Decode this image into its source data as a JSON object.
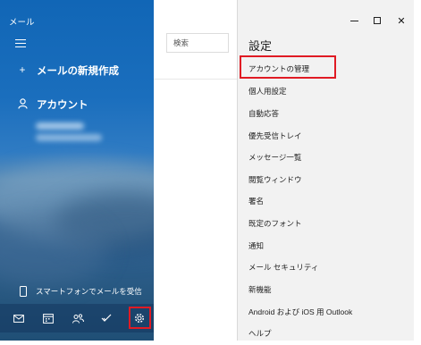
{
  "app": {
    "title": "メール"
  },
  "nav": {
    "new_mail_label": "メールの新規作成",
    "new_mail_icon": "+",
    "accounts_label": "アカウント",
    "phone_label": "スマートフォンでメールを受信",
    "bottom_icons": [
      "mail-icon",
      "calendar-icon",
      "people-icon",
      "todo-icon",
      "gear-icon"
    ]
  },
  "search": {
    "placeholder": "検索"
  },
  "window_controls": {
    "minimize": "minimize-icon",
    "maximize": "maximize-icon",
    "close": "✕"
  },
  "settings": {
    "title": "設定",
    "items": [
      "アカウントの管理",
      "個人用設定",
      "自動応答",
      "優先受信トレイ",
      "メッセージ一覧",
      "閲覧ウィンドウ",
      "署名",
      "既定のフォント",
      "通知",
      "メール セキュリティ",
      "新機能",
      "Android および iOS 用 Outlook",
      "ヘルプ"
    ]
  },
  "colors": {
    "nav_blue": "#1a6ebd",
    "highlight_red": "#e01b24",
    "settings_bg": "#f2f2f2"
  }
}
